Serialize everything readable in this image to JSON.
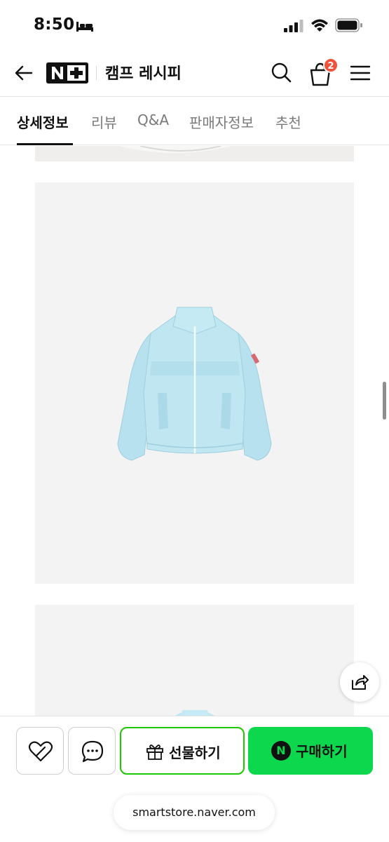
{
  "status_bar": {
    "time": "8:50"
  },
  "header": {
    "logo_text": "N+",
    "store_name": "캠프 레시피",
    "cart_count": "2"
  },
  "tabs": [
    {
      "label": "상세정보",
      "active": true
    },
    {
      "label": "리뷰",
      "active": false
    },
    {
      "label": "Q&A",
      "active": false
    },
    {
      "label": "판매자정보",
      "active": false
    },
    {
      "label": "추천",
      "active": false
    }
  ],
  "bottom_bar": {
    "gift_label": "선물하기",
    "npay_letter": "N",
    "buy_label": "구매하기"
  },
  "browser": {
    "url": "smartstore.naver.com"
  },
  "colors": {
    "accent_green": "#0cd74d",
    "gift_border": "#1ec800",
    "badge_red": "#f0523b",
    "jacket_blue": "#b9e3ef"
  },
  "icons": [
    "bed-icon",
    "signal-icon",
    "wifi-icon",
    "battery-icon",
    "back-icon",
    "search-icon",
    "cart-icon",
    "menu-icon",
    "share-icon",
    "heart-icon",
    "chat-icon",
    "gift-icon"
  ]
}
